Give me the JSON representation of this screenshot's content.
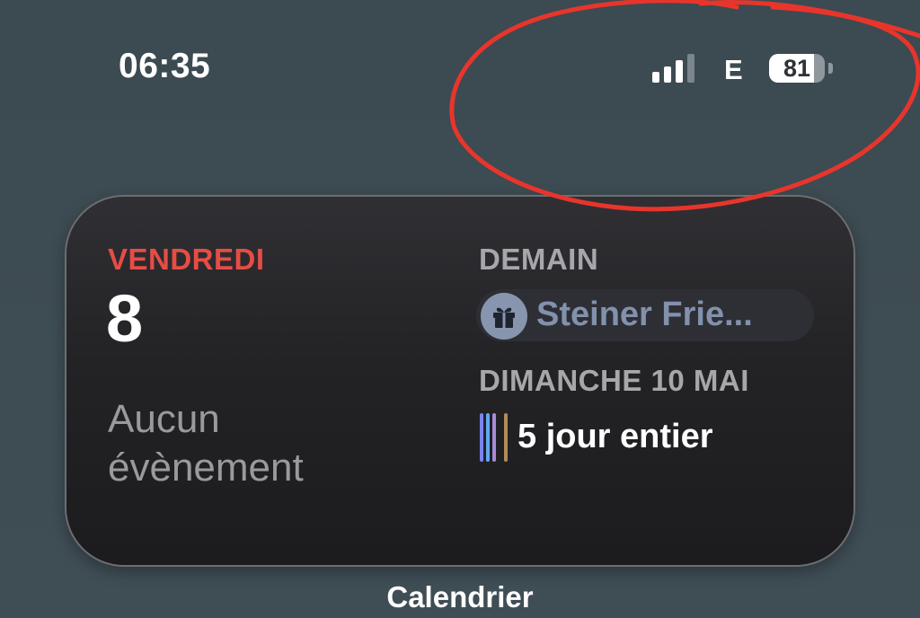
{
  "status_bar": {
    "time": "06:35",
    "signal_bars_active": 3,
    "signal_bars_total": 4,
    "network": "E",
    "battery_percent": "81"
  },
  "widget": {
    "weekday": "VENDREDI",
    "day_number": "8",
    "no_event_line1": "Aucun",
    "no_event_line2": "évènement",
    "tomorrow_label": "DEMAIN",
    "tomorrow_event": "Steiner Frie...",
    "tomorrow_event_icon": "gift-icon",
    "sunday_label": "DIMANCHE 10 MAI",
    "allday_text": "5 jour entier",
    "allday_bar_colors": [
      "#7b83ee",
      "#5ea9f0",
      "#a98ad8",
      "#b28b56"
    ]
  },
  "app_label": "Calendrier",
  "colors": {
    "weekday_red": "#e74c45",
    "event_blue": "#8291ac",
    "annotation_red": "#e8352c"
  }
}
